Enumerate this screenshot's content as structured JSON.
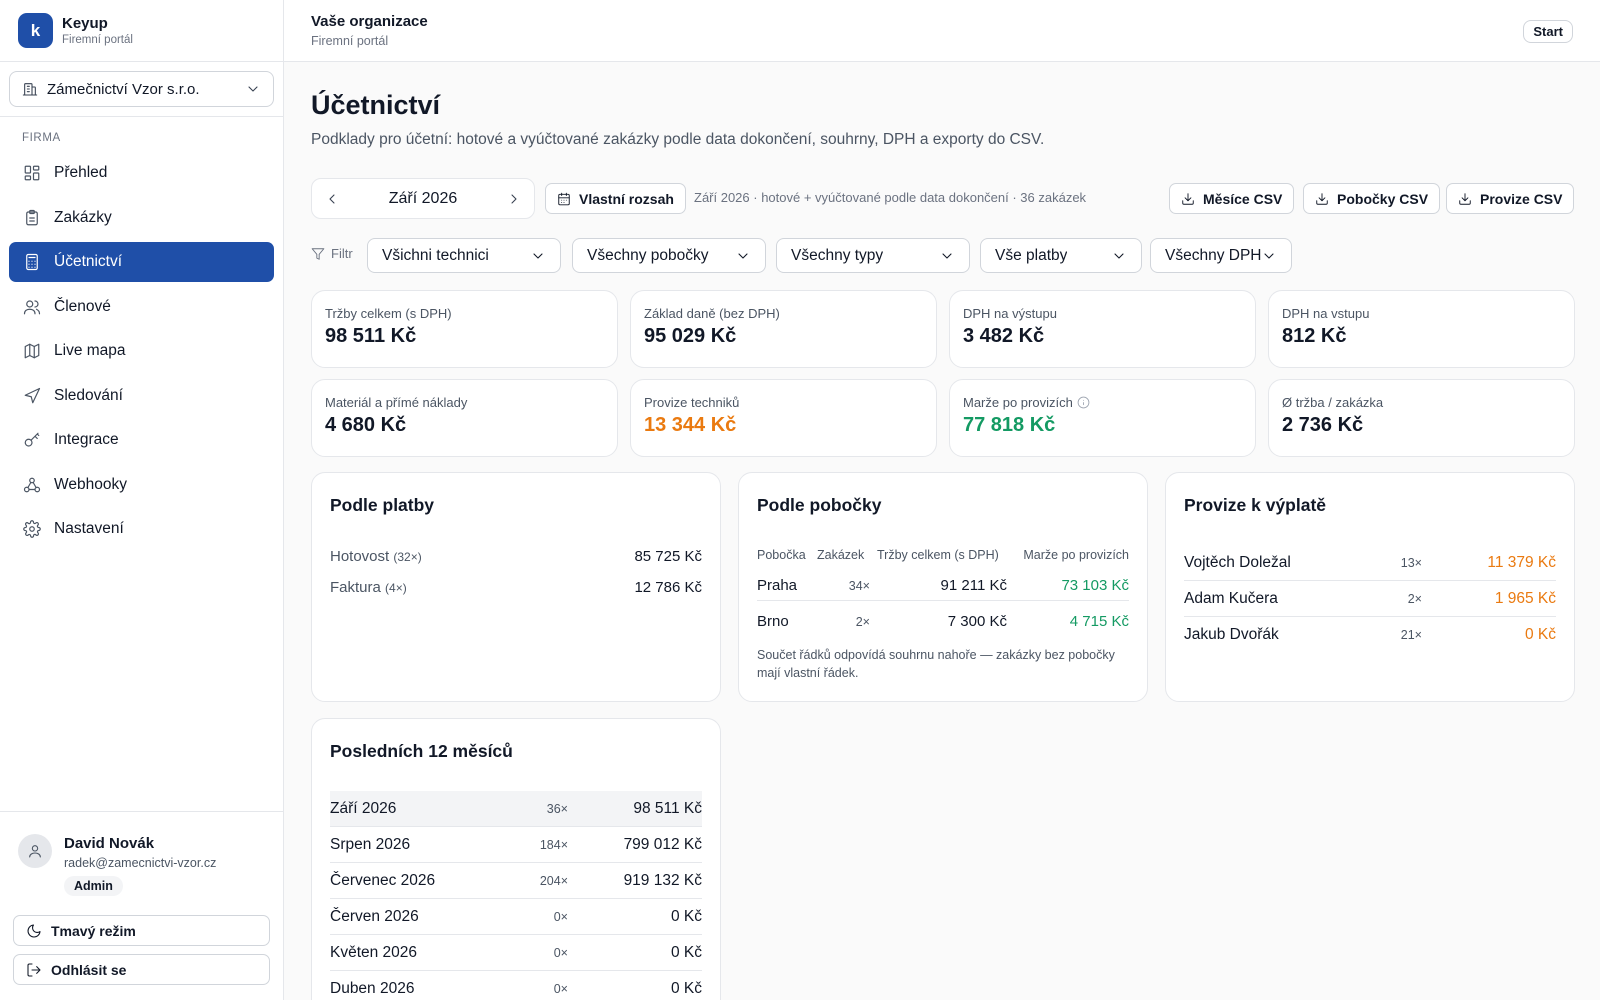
{
  "brand": {
    "name": "Keyup",
    "subtitle": "Firemní portál",
    "logo_letter": "k",
    "logo_color": "#1f4fa8"
  },
  "org_select": {
    "value": "Zámečnictví Vzor s.r.o.",
    "icon": "building-icon"
  },
  "sidebar": {
    "section_label": "FIRMA",
    "items": [
      {
        "label": "Přehled",
        "icon": "dashboard-icon",
        "active": false
      },
      {
        "label": "Zakázky",
        "icon": "clipboard-icon",
        "active": false
      },
      {
        "label": "Účetnictví",
        "icon": "calculator-icon",
        "active": true
      },
      {
        "label": "Členové",
        "icon": "users-icon",
        "active": false
      },
      {
        "label": "Live mapa",
        "icon": "map-icon",
        "active": false
      },
      {
        "label": "Sledování",
        "icon": "navigation-icon",
        "active": false
      },
      {
        "label": "Integrace",
        "icon": "key-icon",
        "active": false
      },
      {
        "label": "Webhooky",
        "icon": "webhook-icon",
        "active": false
      },
      {
        "label": "Nastavení",
        "icon": "gear-icon",
        "active": false
      }
    ]
  },
  "user": {
    "name": "David Novák",
    "email": "radek@zamecnictvi-vzor.cz",
    "role": "Admin",
    "dark_mode_label": "Tmavý režim",
    "logout_label": "Odhlásit se"
  },
  "topbar": {
    "title": "Vaše organizace",
    "subtitle": "Firemní portál",
    "start_label": "Start"
  },
  "page": {
    "title": "Účetnictví",
    "description": "Podklady pro účetní: hotové a vyúčtované zakázky podle data dokončení, souhrny, DPH a exporty do CSV."
  },
  "toolbar": {
    "month": "Září 2026",
    "custom_range_label": "Vlastní rozsah",
    "range_info": "Září 2026 · hotové + vyúčtované podle data dokončení · 36 zakázek",
    "export_months": "Měsíce CSV",
    "export_branches": "Pobočky CSV",
    "export_commissions": "Provize CSV"
  },
  "filters": {
    "label": "Filtr",
    "technicians": "Všichni technici",
    "branches": "Všechny pobočky",
    "types": "Všechny typy",
    "payments": "Vše platby",
    "vat": "Všechny DPH"
  },
  "stats": [
    {
      "label": "Tržby celkem (s DPH)",
      "value": "98 511 Kč",
      "tone": "default"
    },
    {
      "label": "Základ daně (bez DPH)",
      "value": "95 029 Kč",
      "tone": "default"
    },
    {
      "label": "DPH na výstupu",
      "value": "3 482 Kč",
      "tone": "default"
    },
    {
      "label": "DPH na vstupu",
      "value": "812 Kč",
      "tone": "default"
    },
    {
      "label": "Materiál a přímé náklady",
      "value": "4 680 Kč",
      "tone": "default"
    },
    {
      "label": "Provize techniků",
      "value": "13 344 Kč",
      "tone": "orange"
    },
    {
      "label": "Marže po provizích",
      "value": "77 818 Kč",
      "tone": "green",
      "info_icon": "info-icon"
    },
    {
      "label": "Ø tržba / zakázka",
      "value": "2 736 Kč",
      "tone": "default"
    }
  ],
  "by_payment": {
    "title": "Podle platby",
    "rows": [
      {
        "name": "Hotovost",
        "count": "(32×)",
        "value": "85 725 Kč"
      },
      {
        "name": "Faktura",
        "count": "(4×)",
        "value": "12 786 Kč"
      }
    ]
  },
  "by_branch": {
    "title": "Podle pobočky",
    "headers": [
      "Pobočka",
      "Zakázek",
      "Tržby celkem (s DPH)",
      "Marže po provizích"
    ],
    "rows": [
      {
        "name": "Praha",
        "count": "34×",
        "revenue": "91 211 Kč",
        "margin": "73 103 Kč"
      },
      {
        "name": "Brno",
        "count": "2×",
        "revenue": "7 300 Kč",
        "margin": "4 715 Kč"
      }
    ],
    "note": "Součet řádků odpovídá souhrnu nahoře — zakázky bez pobočky mají vlastní řádek."
  },
  "commissions": {
    "title": "Provize k výplatě",
    "rows": [
      {
        "name": "Vojtěch Doležal",
        "count": "13×",
        "value": "11 379 Kč"
      },
      {
        "name": "Adam Kučera",
        "count": "2×",
        "value": "1 965 Kč"
      },
      {
        "name": "Jakub Dvořák",
        "count": "21×",
        "value": "0 Kč"
      }
    ]
  },
  "last12": {
    "title": "Posledních 12 měsíců",
    "rows": [
      {
        "month": "Září 2026",
        "count": "36×",
        "value": "98 511 Kč",
        "highlight": true
      },
      {
        "month": "Srpen 2026",
        "count": "184×",
        "value": "799 012 Kč"
      },
      {
        "month": "Červenec 2026",
        "count": "204×",
        "value": "919 132 Kč"
      },
      {
        "month": "Červen 2026",
        "count": "0×",
        "value": "0 Kč"
      },
      {
        "month": "Květen 2026",
        "count": "0×",
        "value": "0 Kč"
      },
      {
        "month": "Duben 2026",
        "count": "0×",
        "value": "0 Kč"
      }
    ]
  },
  "colors": {
    "accent": "#1f4fa8",
    "commission": "#ea7a10",
    "margin": "#149a63"
  }
}
